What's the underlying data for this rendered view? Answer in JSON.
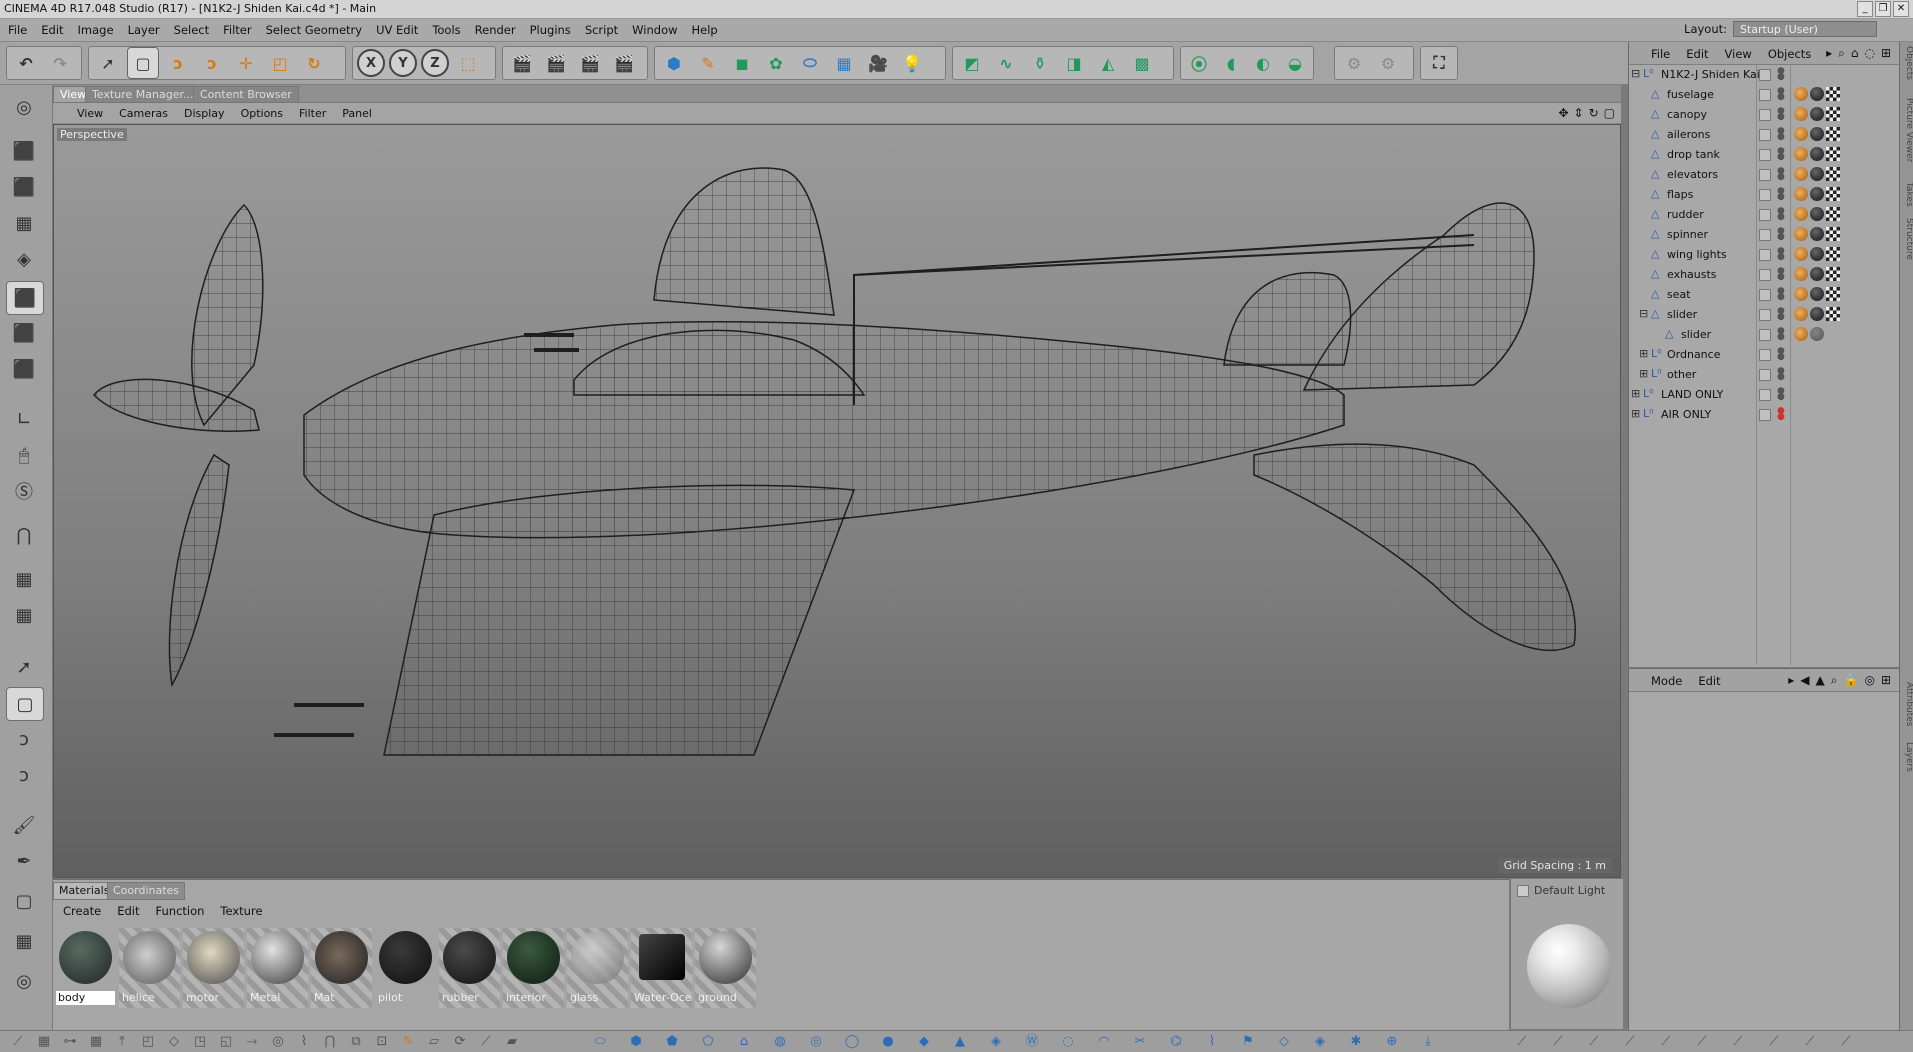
{
  "window": {
    "title": "CINEMA 4D R17.048 Studio (R17) - [N1K2-J Shiden Kai.c4d *] - Main"
  },
  "menubar": {
    "items": [
      "File",
      "Edit",
      "Image",
      "Layer",
      "Select",
      "Filter",
      "Select Geometry",
      "UV Edit",
      "Tools",
      "Render",
      "Plugins",
      "Script",
      "Window",
      "Help"
    ],
    "layout_label": "Layout:",
    "layout_value": "Startup (User)"
  },
  "viewport": {
    "tabs": [
      "View",
      "Texture Manager...",
      "Content Browser"
    ],
    "menu": [
      "View",
      "Cameras",
      "Display",
      "Options",
      "Filter",
      "Panel"
    ],
    "camera_label": "Perspective",
    "grid_spacing": "Grid Spacing : 1 m"
  },
  "materials": {
    "tabs": [
      "Materials",
      "Coordinates"
    ],
    "menu": [
      "Create",
      "Edit",
      "Function",
      "Texture"
    ],
    "items": [
      "body",
      "helice",
      "motor",
      "Metal",
      "Mat",
      "pilot",
      "rubber",
      "interior",
      "glass",
      "Water-Ocea",
      "ground"
    ],
    "preview_label": "Default Light"
  },
  "objects": {
    "menu": [
      "File",
      "Edit",
      "View",
      "Objects"
    ],
    "tree": [
      {
        "name": "N1K2-J Shiden Kai"
      },
      {
        "name": "fuselage"
      },
      {
        "name": "canopy"
      },
      {
        "name": "ailerons"
      },
      {
        "name": "drop tank"
      },
      {
        "name": "elevators"
      },
      {
        "name": "flaps"
      },
      {
        "name": "rudder"
      },
      {
        "name": "spinner"
      },
      {
        "name": "wing lights"
      },
      {
        "name": "exhausts"
      },
      {
        "name": "seat"
      },
      {
        "name": "slider"
      },
      {
        "name": "slider"
      },
      {
        "name": "Ordnance"
      },
      {
        "name": "other"
      },
      {
        "name": "LAND ONLY"
      },
      {
        "name": "AIR ONLY"
      }
    ]
  },
  "attributes": {
    "menu": [
      "Mode",
      "Edit"
    ]
  },
  "side_tabs": [
    "Objects",
    "Picture Viewer",
    "Takes",
    "Structure",
    "Attributes",
    "Layers"
  ],
  "axis_buttons": [
    "X",
    "Y",
    "Z"
  ]
}
